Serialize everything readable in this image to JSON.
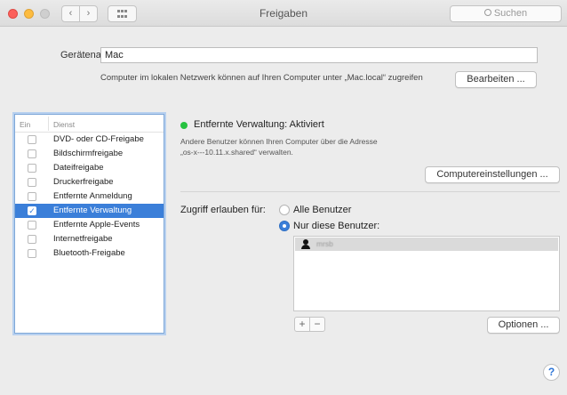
{
  "window": {
    "title": "Freigaben",
    "search_placeholder": "Suchen",
    "nav_back": "‹",
    "nav_forward": "›"
  },
  "device": {
    "label": "Gerätename:",
    "value": "Mac",
    "network_note": "Computer im lokalen Netzwerk können auf Ihren Computer unter „Mac.local“ zugreifen",
    "edit_button": "Bearbeiten ..."
  },
  "services": {
    "header_on": "Ein",
    "header_service": "Dienst",
    "items": [
      {
        "label": "DVD- oder CD-Freigabe",
        "checked": false
      },
      {
        "label": "Bildschirmfreigabe",
        "checked": false
      },
      {
        "label": "Dateifreigabe",
        "checked": false
      },
      {
        "label": "Druckerfreigabe",
        "checked": false
      },
      {
        "label": "Entfernte Anmeldung",
        "checked": false
      },
      {
        "label": "Entfernte Verwaltung",
        "checked": true,
        "selected": true
      },
      {
        "label": "Entfernte Apple-Events",
        "checked": false
      },
      {
        "label": "Internetfreigabe",
        "checked": false
      },
      {
        "label": "Bluetooth-Freigabe",
        "checked": false
      }
    ]
  },
  "detail": {
    "status": "Entfernte Verwaltung: Aktiviert",
    "status_color": "#26c240",
    "desc_line1": "Andere Benutzer können Ihren Computer über die Adresse",
    "desc_line2": "„os-x---10.11.x.shared“ verwalten.",
    "computer_settings_button": "Computereinstellungen ...",
    "access_label": "Zugriff erlauben für:",
    "radio_all": "Alle Benutzer",
    "radio_only": "Nur diese Benutzer:",
    "selected_radio": "only",
    "users": [
      "mrsb"
    ],
    "add_button": "+",
    "remove_button": "−",
    "options_button": "Optionen ..."
  },
  "help": "?",
  "colors": {
    "accent": "#3b7fd9",
    "selection": "#3b7fd9"
  }
}
